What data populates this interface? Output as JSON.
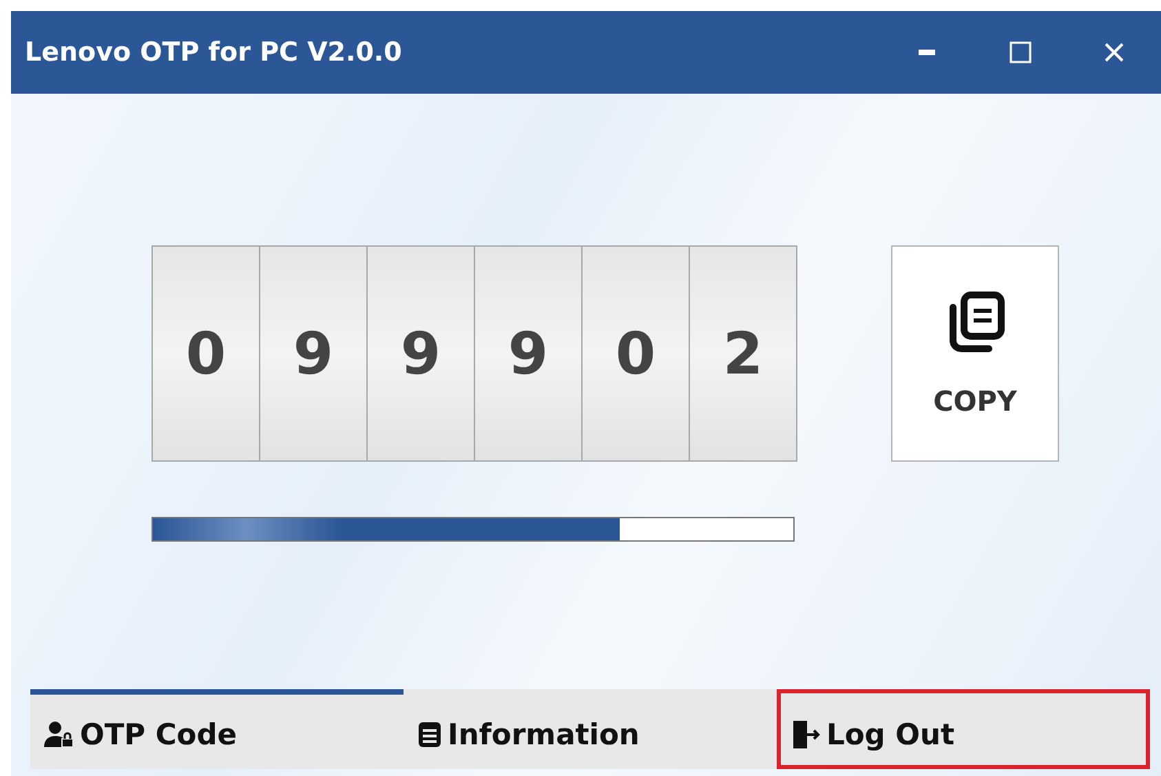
{
  "window": {
    "title": "Lenovo OTP for PC V2.0.0",
    "controls": [
      {
        "kind": "minimize"
      },
      {
        "kind": "maximize"
      },
      {
        "kind": "close"
      }
    ]
  },
  "otp": {
    "digits": [
      "0",
      "9",
      "9",
      "9",
      "0",
      "2"
    ]
  },
  "copy_button": {
    "label": "COPY"
  },
  "timer": {
    "level": 0.73
  },
  "tabs": [
    {
      "label": "OTP Code",
      "kind": "account",
      "selected": true,
      "highlighted": false
    },
    {
      "label": "Information",
      "kind": "info",
      "selected": false,
      "highlighted": false
    },
    {
      "label": "Log Out",
      "kind": "logout",
      "selected": false,
      "highlighted": true
    }
  ]
}
